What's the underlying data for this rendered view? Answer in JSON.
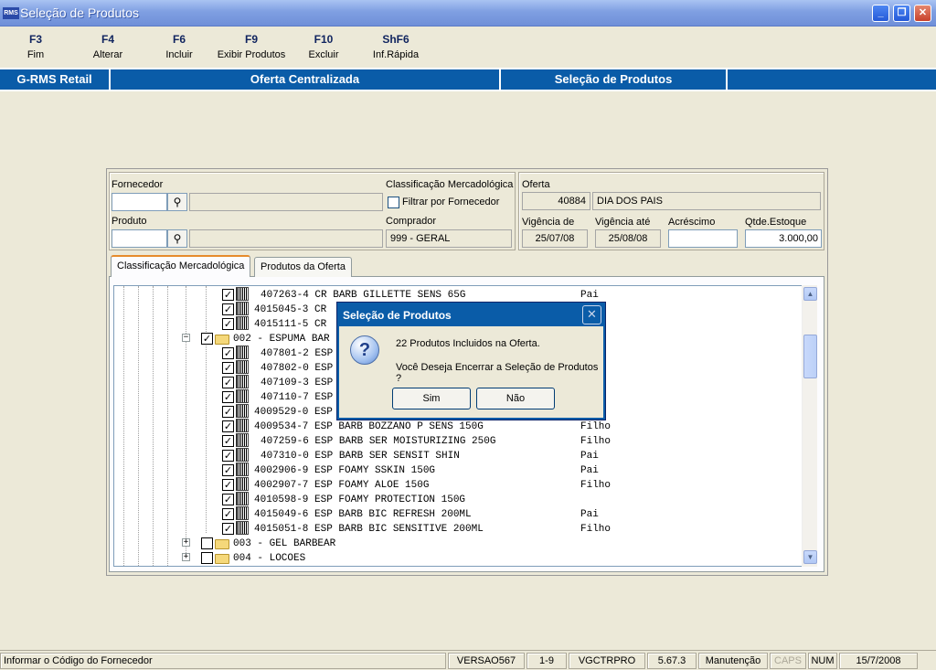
{
  "window": {
    "title": "Seleção de Produtos",
    "icon_text": "RMS",
    "min": "_",
    "max": "❐",
    "close": "✕"
  },
  "fkeys": [
    {
      "key": "F3",
      "label": "Fim"
    },
    {
      "key": "F4",
      "label": "Alterar"
    },
    {
      "key": "F6",
      "label": "Incluir"
    },
    {
      "key": "F9",
      "label": "Exibir Produtos"
    },
    {
      "key": "F10",
      "label": "Excluir"
    },
    {
      "key": "ShF6",
      "label": "Inf.Rápida"
    }
  ],
  "nav": {
    "app": "G-RMS Retail",
    "module": "Oferta Centralizada",
    "screen": "Seleção de Produtos"
  },
  "form": {
    "fornecedor_label": "Fornecedor",
    "fornecedor_value": "",
    "fornecedor_desc": "",
    "produto_label": "Produto",
    "produto_value": "",
    "produto_desc": "",
    "classif_label": "Classificação Mercadológica",
    "filtrar_label": "Filtrar por Fornecedor",
    "comprador_label": "Comprador",
    "comprador_value": "999 - GERAL",
    "oferta_label": "Oferta",
    "oferta_num": "40884",
    "oferta_desc": "DIA DOS PAIS",
    "vig_de_label": "Vigência de",
    "vig_de": "25/07/08",
    "vig_ate_label": "Vigência até",
    "vig_ate": "25/08/08",
    "acrescimo_label": "Acréscimo",
    "acrescimo": "",
    "qtde_label": "Qtde.Estoque",
    "qtde": "3.000,00"
  },
  "tabs": [
    "Classificação Mercadológica",
    "Produtos da Oferta"
  ],
  "tree": {
    "rows": [
      {
        "text": "407263-4 CR BARB GILLETTE SENS 65G",
        "type": "Pai"
      },
      {
        "text": "4015045-3 CR",
        "type": ""
      },
      {
        "text": "4015111-5 CR",
        "type": "o"
      },
      {
        "text": "002 - ESPUMA BAR",
        "type": ""
      },
      {
        "text": "407801-2 ESP",
        "type": "o"
      },
      {
        "text": "407802-0 ESP",
        "type": ""
      },
      {
        "text": "407109-3 ESP",
        "type": "o"
      },
      {
        "text": "407110-7 ESP",
        "type": ""
      },
      {
        "text": "4009529-0 ESP",
        "type": ""
      },
      {
        "text": "4009534-7 ESP BARB BOZZANO P SENS 150G",
        "type": "Filho"
      },
      {
        "text": "407259-6 ESP BARB SER MOISTURIZING 250G",
        "type": "Filho"
      },
      {
        "text": "407310-0 ESP BARB SER SENSIT SHIN",
        "type": "Pai"
      },
      {
        "text": "4002906-9 ESP FOAMY SSKIN 150G",
        "type": "Pai"
      },
      {
        "text": "4002907-7 ESP FOAMY ALOE 150G",
        "type": "Filho"
      },
      {
        "text": "4010598-9 ESP FOAMY PROTECTION 150G",
        "type": ""
      },
      {
        "text": "4015049-6 ESP BARB BIC REFRESH 200ML",
        "type": "Pai"
      },
      {
        "text": "4015051-8 ESP BARB BIC SENSITIVE 200ML",
        "type": "Filho"
      },
      {
        "text": "003 - GEL BARBEAR",
        "type": ""
      },
      {
        "text": "004 - LOCOES",
        "type": ""
      }
    ]
  },
  "dialog": {
    "title": "Seleção de Produtos",
    "line1": "22 Produtos Incluidos na Oferta.",
    "line2": "Você Deseja Encerrar a Seleção de Produtos ?",
    "yes": "Sim",
    "no": "Não",
    "close": "✕",
    "icon": "?"
  },
  "status": {
    "message": "Informar o Código do Fornecedor",
    "version": "VERSAO567",
    "page": "1-9",
    "program": "VGCTRPRO",
    "build": "5.67.3",
    "mode": "Manutenção",
    "caps": "CAPS",
    "num": "NUM",
    "date": "15/7/2008"
  }
}
